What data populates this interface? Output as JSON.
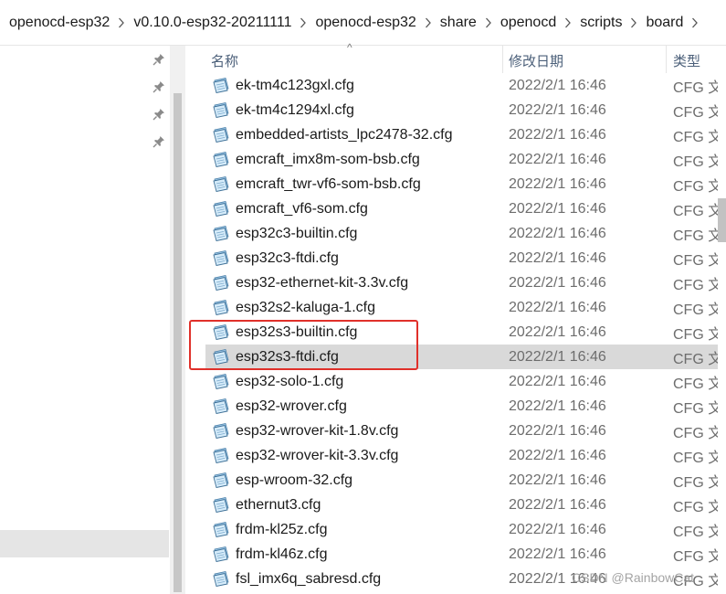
{
  "breadcrumb": {
    "items": [
      "openocd-esp32",
      "v0.10.0-esp32-20211111",
      "openocd-esp32",
      "share",
      "openocd",
      "scripts",
      "board"
    ]
  },
  "columns": {
    "name": "名称",
    "date_modified": "修改日期",
    "type": "类型"
  },
  "files": [
    {
      "name": "ek-tm4c123gxl.cfg",
      "date": "2022/2/1 16:46",
      "type": "CFG 文"
    },
    {
      "name": "ek-tm4c1294xl.cfg",
      "date": "2022/2/1 16:46",
      "type": "CFG 文"
    },
    {
      "name": "embedded-artists_lpc2478-32.cfg",
      "date": "2022/2/1 16:46",
      "type": "CFG 文"
    },
    {
      "name": "emcraft_imx8m-som-bsb.cfg",
      "date": "2022/2/1 16:46",
      "type": "CFG 文"
    },
    {
      "name": "emcraft_twr-vf6-som-bsb.cfg",
      "date": "2022/2/1 16:46",
      "type": "CFG 文"
    },
    {
      "name": "emcraft_vf6-som.cfg",
      "date": "2022/2/1 16:46",
      "type": "CFG 文"
    },
    {
      "name": "esp32c3-builtin.cfg",
      "date": "2022/2/1 16:46",
      "type": "CFG 文"
    },
    {
      "name": "esp32c3-ftdi.cfg",
      "date": "2022/2/1 16:46",
      "type": "CFG 文"
    },
    {
      "name": "esp32-ethernet-kit-3.3v.cfg",
      "date": "2022/2/1 16:46",
      "type": "CFG 文"
    },
    {
      "name": "esp32s2-kaluga-1.cfg",
      "date": "2022/2/1 16:46",
      "type": "CFG 文"
    },
    {
      "name": "esp32s3-builtin.cfg",
      "date": "2022/2/1 16:46",
      "type": "CFG 文"
    },
    {
      "name": "esp32s3-ftdi.cfg",
      "date": "2022/2/1 16:46",
      "type": "CFG 文",
      "selected": true
    },
    {
      "name": "esp32-solo-1.cfg",
      "date": "2022/2/1 16:46",
      "type": "CFG 文"
    },
    {
      "name": "esp32-wrover.cfg",
      "date": "2022/2/1 16:46",
      "type": "CFG 文"
    },
    {
      "name": "esp32-wrover-kit-1.8v.cfg",
      "date": "2022/2/1 16:46",
      "type": "CFG 文"
    },
    {
      "name": "esp32-wrover-kit-3.3v.cfg",
      "date": "2022/2/1 16:46",
      "type": "CFG 文"
    },
    {
      "name": "esp-wroom-32.cfg",
      "date": "2022/2/1 16:46",
      "type": "CFG 文"
    },
    {
      "name": "ethernut3.cfg",
      "date": "2022/2/1 16:46",
      "type": "CFG 文"
    },
    {
      "name": "frdm-kl25z.cfg",
      "date": "2022/2/1 16:46",
      "type": "CFG 文"
    },
    {
      "name": "frdm-kl46z.cfg",
      "date": "2022/2/1 16:46",
      "type": "CFG 文"
    },
    {
      "name": "fsl_imx6q_sabresd.cfg",
      "date": "2022/2/1 16:46",
      "type": "CFG 文"
    }
  ],
  "watermark": "CSDN @RainbowCat",
  "colors": {
    "highlight": "#e0302a",
    "selected_row": "#d9d9d9",
    "header_text": "#4c607a"
  },
  "icons": {
    "file": "cfg-file-icon",
    "pin": "pin-icon",
    "separator": "chevron-right-icon"
  }
}
